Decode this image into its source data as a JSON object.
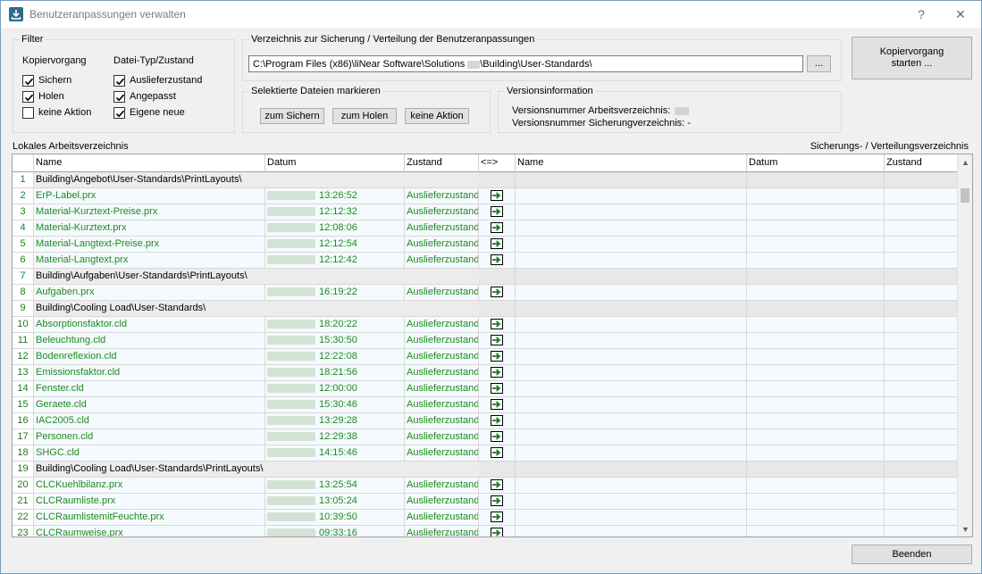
{
  "window": {
    "title": "Benutzeranpassungen verwalten",
    "help": "?",
    "close": "✕"
  },
  "filter": {
    "label": "Filter",
    "copy_title": "Kopiervorgang",
    "type_title": "Datei-Typ/Zustand",
    "copy_options": [
      {
        "label": "Sichern",
        "checked": true
      },
      {
        "label": "Holen",
        "checked": true
      },
      {
        "label": "keine Aktion",
        "checked": false
      }
    ],
    "type_options": [
      {
        "label": "Auslieferzustand",
        "checked": true
      },
      {
        "label": "Angepasst",
        "checked": true
      },
      {
        "label": "Eigene neue",
        "checked": true
      }
    ]
  },
  "directory": {
    "label": "Verzeichnis zur Sicherung / Verteilung der Benutzeranpassungen",
    "path_prefix": "C:\\Program Files (x86)\\liNear Software\\Solutions ",
    "path_suffix": "\\Building\\User-Standards\\",
    "browse": "..."
  },
  "mark": {
    "label": "Selektierte Dateien markieren",
    "buttons": [
      "zum Sichern",
      "zum Holen",
      "keine Aktion"
    ]
  },
  "version": {
    "label": "Versionsinformation",
    "work_label": "Versionsnummer Arbeitsverzeichnis:",
    "backup_label": "Versionsnummer Sicherungverzeichnis: -"
  },
  "start_button": "Kopiervorgang starten ...",
  "local_label": "Lokales Arbeitsverzeichnis",
  "remote_label": "Sicherungs- / Verteilungsverzeichnis",
  "columns": {
    "name": "Name",
    "date": "Datum",
    "state": "Zustand",
    "dir": "<=>",
    "r_name": "Name",
    "r_date": "Datum",
    "r_state": "Zustand"
  },
  "rows": [
    {
      "n": "1",
      "group": true,
      "name": "Building\\Angebot\\User-Standards\\PrintLayouts\\"
    },
    {
      "n": "2",
      "name": "ErP-Label.prx",
      "time": "13:26:52",
      "state": "Auslieferzustand"
    },
    {
      "n": "3",
      "name": "Material-Kurztext-Preise.prx",
      "time": "12:12:32",
      "state": "Auslieferzustand"
    },
    {
      "n": "4",
      "name": "Material-Kurztext.prx",
      "time": "12:08:06",
      "state": "Auslieferzustand"
    },
    {
      "n": "5",
      "name": "Material-Langtext-Preise.prx",
      "time": "12:12:54",
      "state": "Auslieferzustand"
    },
    {
      "n": "6",
      "name": "Material-Langtext.prx",
      "time": "12:12:42",
      "state": "Auslieferzustand"
    },
    {
      "n": "7",
      "group": true,
      "name": "Building\\Aufgaben\\User-Standards\\PrintLayouts\\"
    },
    {
      "n": "8",
      "name": "Aufgaben.prx",
      "time": "16:19:22",
      "state": "Auslieferzustand"
    },
    {
      "n": "9",
      "group": true,
      "name": "Building\\Cooling Load\\User-Standards\\"
    },
    {
      "n": "10",
      "name": "Absorptionsfaktor.cld",
      "time": "18:20:22",
      "state": "Auslieferzustand"
    },
    {
      "n": "11",
      "name": "Beleuchtung.cld",
      "time": "15:30:50",
      "state": "Auslieferzustand"
    },
    {
      "n": "12",
      "name": "Bodenreflexion.cld",
      "time": "12:22:08",
      "state": "Auslieferzustand"
    },
    {
      "n": "13",
      "name": "Emissionsfaktor.cld",
      "time": "18:21:56",
      "state": "Auslieferzustand"
    },
    {
      "n": "14",
      "name": "Fenster.cld",
      "time": "12:00:00",
      "state": "Auslieferzustand"
    },
    {
      "n": "15",
      "name": "Geraete.cld",
      "time": "15:30:46",
      "state": "Auslieferzustand"
    },
    {
      "n": "16",
      "name": "IAC2005.cld",
      "time": "13:29:28",
      "state": "Auslieferzustand"
    },
    {
      "n": "17",
      "name": "Personen.cld",
      "time": "12:29:38",
      "state": "Auslieferzustand"
    },
    {
      "n": "18",
      "name": "SHGC.cld",
      "time": "14:15:46",
      "state": "Auslieferzustand"
    },
    {
      "n": "19",
      "group": true,
      "name": "Building\\Cooling Load\\User-Standards\\PrintLayouts\\"
    },
    {
      "n": "20",
      "name": "CLCKuehlbilanz.prx",
      "time": "13:25:54",
      "state": "Auslieferzustand"
    },
    {
      "n": "21",
      "name": "CLCRaumliste.prx",
      "time": "13:05:24",
      "state": "Auslieferzustand"
    },
    {
      "n": "22",
      "name": "CLCRaumlistemitFeuchte.prx",
      "time": "10:39:50",
      "state": "Auslieferzustand"
    },
    {
      "n": "23",
      "name": "CLCRaumweise.prx",
      "time": "09:33:16",
      "state": "Auslieferzustand"
    }
  ],
  "close_button": "Beenden",
  "colors": {
    "accent_green": "#1f8a1f",
    "window_border": "#7a9bbd"
  }
}
